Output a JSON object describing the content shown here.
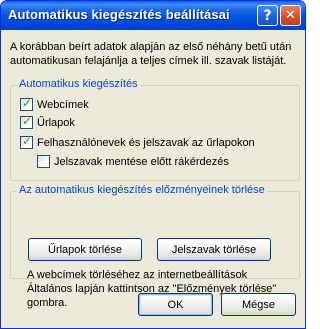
{
  "window": {
    "title": "Automatikus kiegészítés beállításai",
    "help_glyph": "?",
    "close_glyph": "✕"
  },
  "intro_text": "A korábban beírt adatok alapján az első néhány betű után automatikusan felajánlja a teljes címek ill. szavak listáját.",
  "autocomplete_group": {
    "legend": "Automatikus kiegészítés",
    "options": [
      {
        "label": "Webcímek",
        "checked": true
      },
      {
        "label": "Űrlapok",
        "checked": true
      },
      {
        "label": "Felhasználónevek és jelszavak az űrlapokon",
        "checked": true
      },
      {
        "label": "Jelszavak mentése előtt rákérdezés",
        "checked": false
      }
    ]
  },
  "history_group": {
    "legend": "Az automatikus kiegészítés előzményeinek törlése",
    "delete_forms_label": "Űrlapok törlése",
    "delete_passwords_label": "Jelszavak törlése",
    "note": "A webcímek törléséhez az internetbeállítások Általános lapján kattintson az \"Előzmények törlése\" gombra."
  },
  "buttons": {
    "ok_label": "OK",
    "cancel_label": "Mégse"
  },
  "colors": {
    "titlebar": "#0054e3",
    "dialog_bg": "#ece9d8",
    "legend_text": "#0046d5",
    "checkmark": "#21a121",
    "close_button": "#d3532f"
  },
  "icons": [
    "help-icon",
    "close-icon",
    "checkmark-icon"
  ]
}
